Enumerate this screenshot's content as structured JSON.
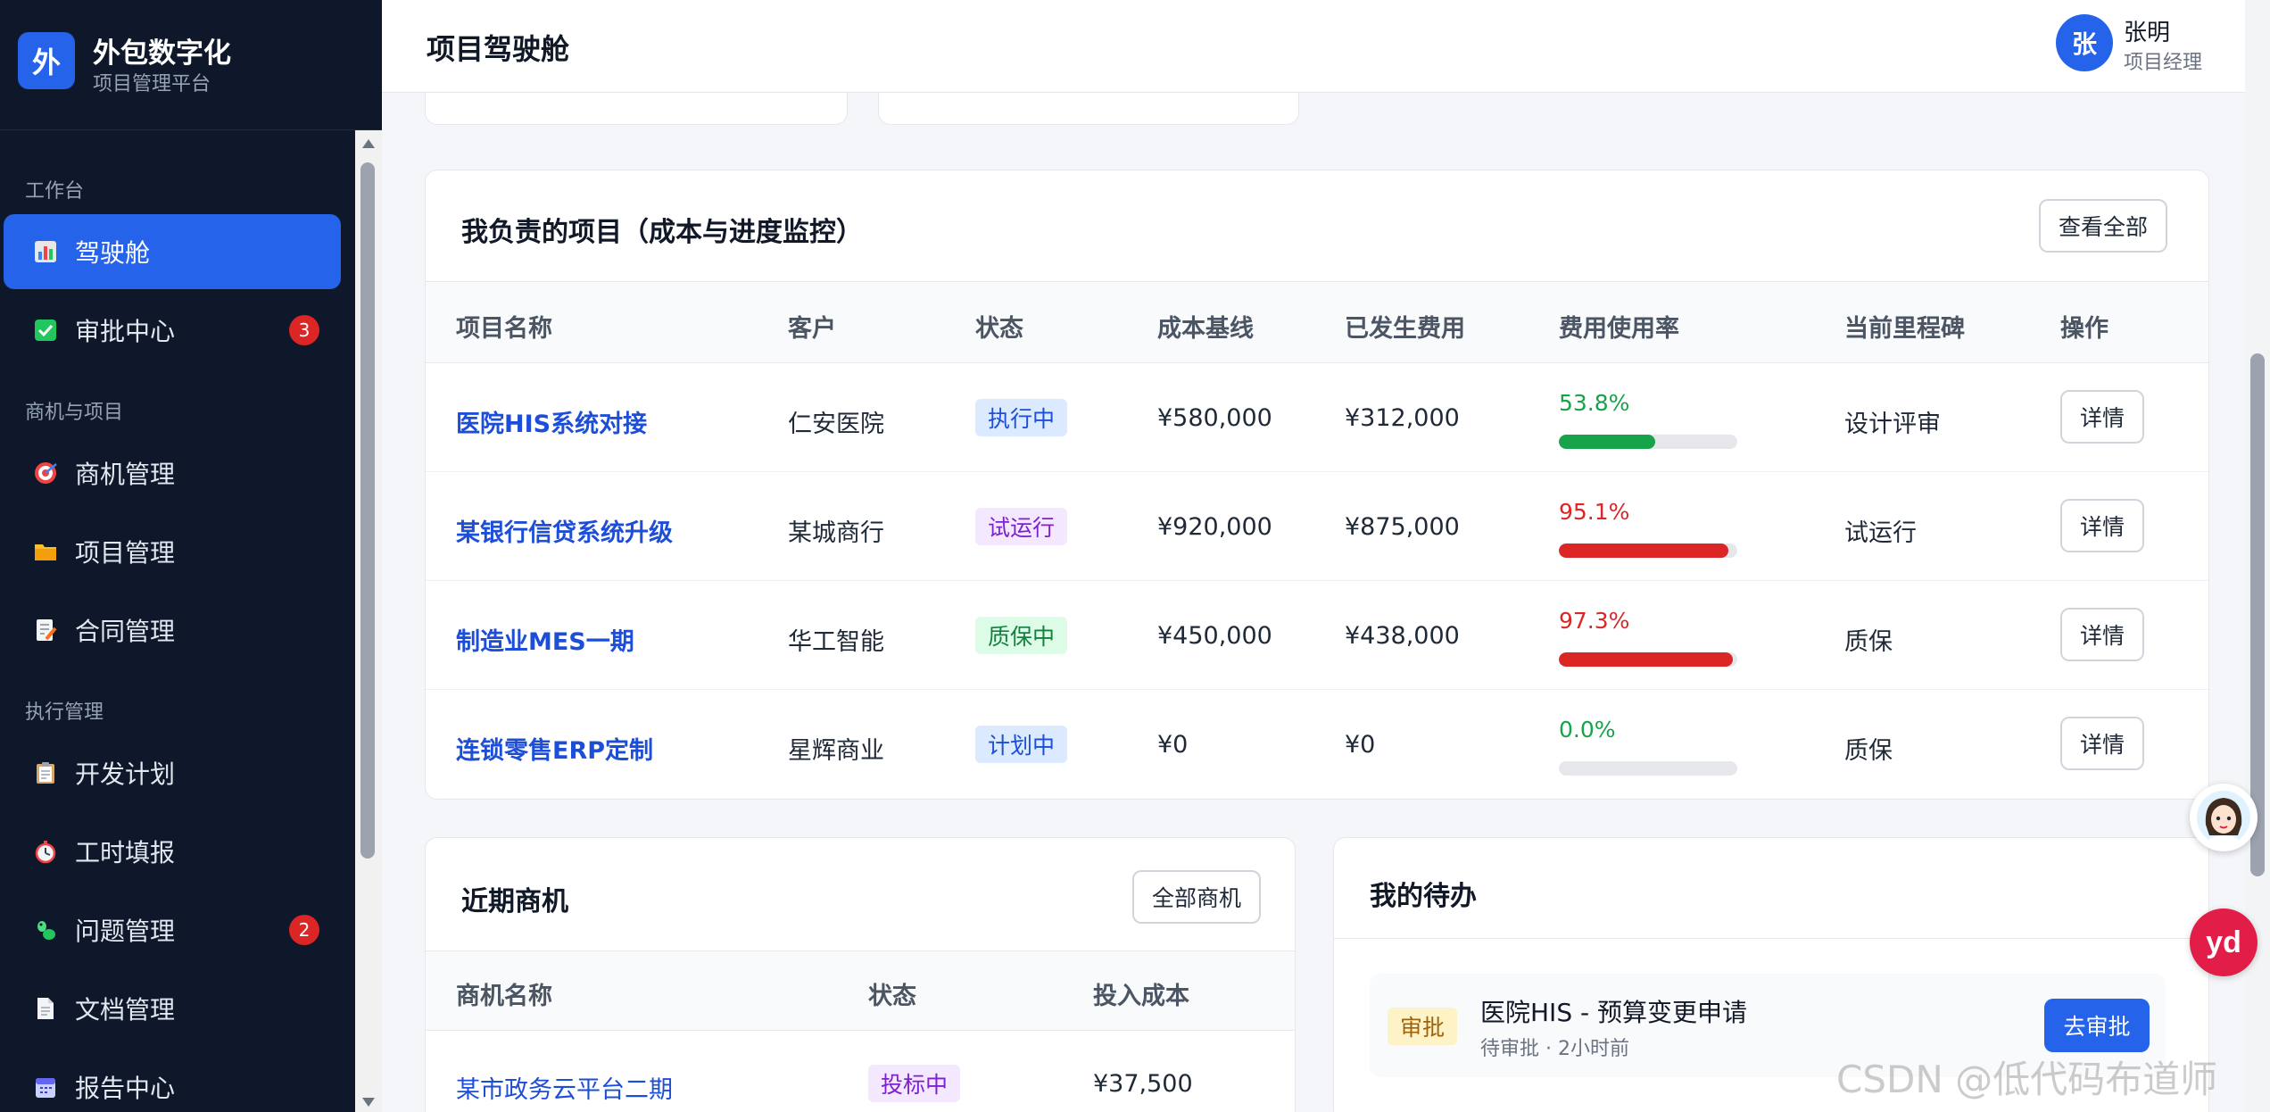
{
  "brand": {
    "logo": "外",
    "title": "外包数字化",
    "subtitle": "项目管理平台"
  },
  "sidebar": {
    "groups": [
      "工作台",
      "商机与项目",
      "执行管理"
    ],
    "items": [
      {
        "label": "驾驶舱",
        "icon": "chart-icon",
        "active": true
      },
      {
        "label": "审批中心",
        "icon": "check-icon",
        "badge": "3"
      },
      {
        "label": "商机管理",
        "icon": "target-icon"
      },
      {
        "label": "项目管理",
        "icon": "folder-icon"
      },
      {
        "label": "合同管理",
        "icon": "document-pen-icon"
      },
      {
        "label": "开发计划",
        "icon": "clipboard-icon"
      },
      {
        "label": "工时填报",
        "icon": "stopwatch-icon"
      },
      {
        "label": "问题管理",
        "icon": "bug-icon",
        "badge": "2"
      },
      {
        "label": "文档管理",
        "icon": "file-icon"
      },
      {
        "label": "报告中心",
        "icon": "calendar-icon"
      }
    ]
  },
  "header": {
    "title": "项目驾驶舱",
    "avatar": "张",
    "user_name": "张明",
    "user_role": "项目经理"
  },
  "projects": {
    "title": "我负责的项目（成本与进度监控）",
    "view_all": "查看全部",
    "columns": [
      "项目名称",
      "客户",
      "状态",
      "成本基线",
      "已发生费用",
      "费用使用率",
      "当前里程碑",
      "操作"
    ],
    "rows": [
      {
        "name": "医院HIS系统对接",
        "client": "仁安医院",
        "status": "执行中",
        "baseline": "¥580,000",
        "spent": "¥312,000",
        "rate_text": "53.8%",
        "rate": 0.538,
        "milestone": "设计评审",
        "action": "详情"
      },
      {
        "name": "某银行信贷系统升级",
        "client": "某城商行",
        "status": "试运行",
        "baseline": "¥920,000",
        "spent": "¥875,000",
        "rate_text": "95.1%",
        "rate": 0.951,
        "milestone": "试运行",
        "action": "详情"
      },
      {
        "name": "制造业MES一期",
        "client": "华工智能",
        "status": "质保中",
        "baseline": "¥450,000",
        "spent": "¥438,000",
        "rate_text": "97.3%",
        "rate": 0.973,
        "milestone": "质保",
        "action": "详情"
      },
      {
        "name": "连锁零售ERP定制",
        "client": "星辉商业",
        "status": "计划中",
        "baseline": "¥0",
        "spent": "¥0",
        "rate_text": "0.0%",
        "rate": 0.0,
        "milestone": "质保",
        "action": "详情"
      }
    ]
  },
  "opportunities": {
    "title": "近期商机",
    "all_button": "全部商机",
    "columns": [
      "商机名称",
      "状态",
      "投入成本"
    ],
    "rows": [
      {
        "name": "某市政务云平台二期",
        "status": "投标中",
        "cost": "¥37,500"
      }
    ]
  },
  "todos": {
    "title": "我的待办",
    "items": [
      {
        "tag": "审批",
        "title": "医院HIS - 预算变更申请",
        "meta": "待审批 · 2小时前",
        "action": "去审批"
      }
    ]
  },
  "floating": {
    "assistant_icon": "assistant-avatar-icon",
    "yd_label": "yd"
  },
  "watermark": "CSDN @低代码布道师",
  "colors": {
    "primary": "#2563eb",
    "sidebar_bg": "#0f172a",
    "success": "#16a34a",
    "danger": "#dc2626",
    "tag_blue_bg": "#dbeafe",
    "tag_purple_bg": "#f3e8ff",
    "tag_green_bg": "#dcfce7"
  }
}
